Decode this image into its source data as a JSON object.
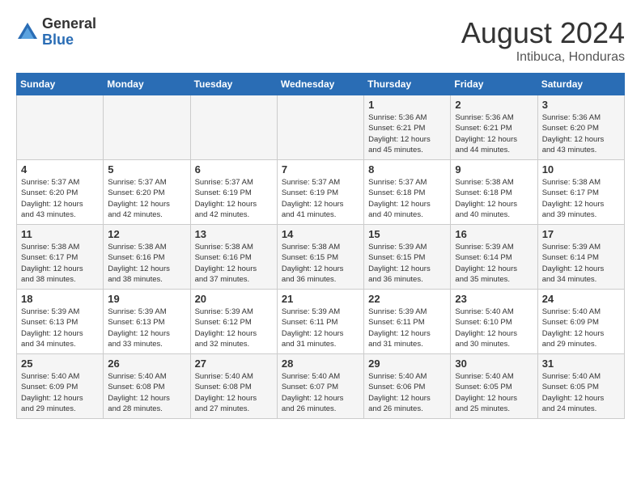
{
  "header": {
    "logo_general": "General",
    "logo_blue": "Blue",
    "month_year": "August 2024",
    "location": "Intibuca, Honduras"
  },
  "days_of_week": [
    "Sunday",
    "Monday",
    "Tuesday",
    "Wednesday",
    "Thursday",
    "Friday",
    "Saturday"
  ],
  "weeks": [
    [
      {
        "day": "",
        "info": ""
      },
      {
        "day": "",
        "info": ""
      },
      {
        "day": "",
        "info": ""
      },
      {
        "day": "",
        "info": ""
      },
      {
        "day": "1",
        "info": "Sunrise: 5:36 AM\nSunset: 6:21 PM\nDaylight: 12 hours\nand 45 minutes."
      },
      {
        "day": "2",
        "info": "Sunrise: 5:36 AM\nSunset: 6:21 PM\nDaylight: 12 hours\nand 44 minutes."
      },
      {
        "day": "3",
        "info": "Sunrise: 5:36 AM\nSunset: 6:20 PM\nDaylight: 12 hours\nand 43 minutes."
      }
    ],
    [
      {
        "day": "4",
        "info": "Sunrise: 5:37 AM\nSunset: 6:20 PM\nDaylight: 12 hours\nand 43 minutes."
      },
      {
        "day": "5",
        "info": "Sunrise: 5:37 AM\nSunset: 6:20 PM\nDaylight: 12 hours\nand 42 minutes."
      },
      {
        "day": "6",
        "info": "Sunrise: 5:37 AM\nSunset: 6:19 PM\nDaylight: 12 hours\nand 42 minutes."
      },
      {
        "day": "7",
        "info": "Sunrise: 5:37 AM\nSunset: 6:19 PM\nDaylight: 12 hours\nand 41 minutes."
      },
      {
        "day": "8",
        "info": "Sunrise: 5:37 AM\nSunset: 6:18 PM\nDaylight: 12 hours\nand 40 minutes."
      },
      {
        "day": "9",
        "info": "Sunrise: 5:38 AM\nSunset: 6:18 PM\nDaylight: 12 hours\nand 40 minutes."
      },
      {
        "day": "10",
        "info": "Sunrise: 5:38 AM\nSunset: 6:17 PM\nDaylight: 12 hours\nand 39 minutes."
      }
    ],
    [
      {
        "day": "11",
        "info": "Sunrise: 5:38 AM\nSunset: 6:17 PM\nDaylight: 12 hours\nand 38 minutes."
      },
      {
        "day": "12",
        "info": "Sunrise: 5:38 AM\nSunset: 6:16 PM\nDaylight: 12 hours\nand 38 minutes."
      },
      {
        "day": "13",
        "info": "Sunrise: 5:38 AM\nSunset: 6:16 PM\nDaylight: 12 hours\nand 37 minutes."
      },
      {
        "day": "14",
        "info": "Sunrise: 5:38 AM\nSunset: 6:15 PM\nDaylight: 12 hours\nand 36 minutes."
      },
      {
        "day": "15",
        "info": "Sunrise: 5:39 AM\nSunset: 6:15 PM\nDaylight: 12 hours\nand 36 minutes."
      },
      {
        "day": "16",
        "info": "Sunrise: 5:39 AM\nSunset: 6:14 PM\nDaylight: 12 hours\nand 35 minutes."
      },
      {
        "day": "17",
        "info": "Sunrise: 5:39 AM\nSunset: 6:14 PM\nDaylight: 12 hours\nand 34 minutes."
      }
    ],
    [
      {
        "day": "18",
        "info": "Sunrise: 5:39 AM\nSunset: 6:13 PM\nDaylight: 12 hours\nand 34 minutes."
      },
      {
        "day": "19",
        "info": "Sunrise: 5:39 AM\nSunset: 6:13 PM\nDaylight: 12 hours\nand 33 minutes."
      },
      {
        "day": "20",
        "info": "Sunrise: 5:39 AM\nSunset: 6:12 PM\nDaylight: 12 hours\nand 32 minutes."
      },
      {
        "day": "21",
        "info": "Sunrise: 5:39 AM\nSunset: 6:11 PM\nDaylight: 12 hours\nand 31 minutes."
      },
      {
        "day": "22",
        "info": "Sunrise: 5:39 AM\nSunset: 6:11 PM\nDaylight: 12 hours\nand 31 minutes."
      },
      {
        "day": "23",
        "info": "Sunrise: 5:40 AM\nSunset: 6:10 PM\nDaylight: 12 hours\nand 30 minutes."
      },
      {
        "day": "24",
        "info": "Sunrise: 5:40 AM\nSunset: 6:09 PM\nDaylight: 12 hours\nand 29 minutes."
      }
    ],
    [
      {
        "day": "25",
        "info": "Sunrise: 5:40 AM\nSunset: 6:09 PM\nDaylight: 12 hours\nand 29 minutes."
      },
      {
        "day": "26",
        "info": "Sunrise: 5:40 AM\nSunset: 6:08 PM\nDaylight: 12 hours\nand 28 minutes."
      },
      {
        "day": "27",
        "info": "Sunrise: 5:40 AM\nSunset: 6:08 PM\nDaylight: 12 hours\nand 27 minutes."
      },
      {
        "day": "28",
        "info": "Sunrise: 5:40 AM\nSunset: 6:07 PM\nDaylight: 12 hours\nand 26 minutes."
      },
      {
        "day": "29",
        "info": "Sunrise: 5:40 AM\nSunset: 6:06 PM\nDaylight: 12 hours\nand 26 minutes."
      },
      {
        "day": "30",
        "info": "Sunrise: 5:40 AM\nSunset: 6:05 PM\nDaylight: 12 hours\nand 25 minutes."
      },
      {
        "day": "31",
        "info": "Sunrise: 5:40 AM\nSunset: 6:05 PM\nDaylight: 12 hours\nand 24 minutes."
      }
    ]
  ]
}
